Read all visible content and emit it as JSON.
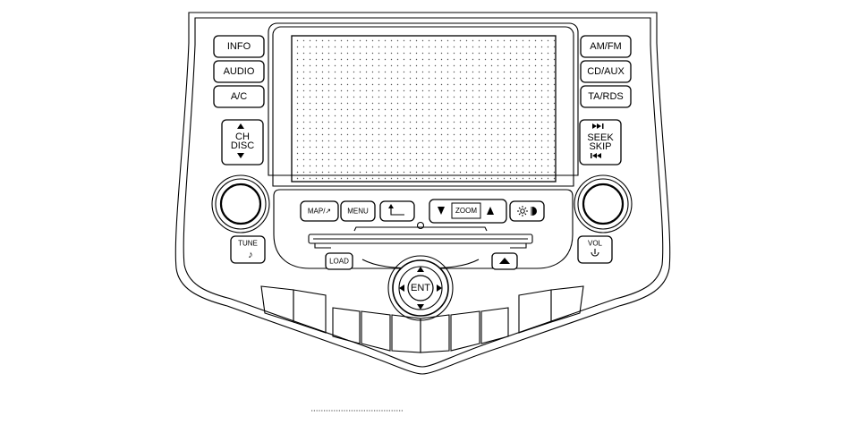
{
  "left_buttons": {
    "info": "INFO",
    "audio": "AUDIO",
    "ac": "A/C"
  },
  "right_buttons": {
    "am_fm": "AM/FM",
    "cd_aux": "CD/AUX",
    "ta_rds": "TA/RDS"
  },
  "ch_disc": {
    "line1": "CH",
    "line2": "DISC"
  },
  "seek_skip": {
    "line1": "SEEK",
    "line2": "SKIP"
  },
  "tune": {
    "label": "TUNE",
    "icon": "music-note-icon"
  },
  "vol": {
    "label": "VOL",
    "icon": "power-icon"
  },
  "screen_row": {
    "map": "MAP/↗",
    "menu": "MENU",
    "zoom": "ZOOM",
    "back_icon": "back-arrow-icon",
    "brightness_icon": "day-night-icon"
  },
  "load": "LOAD",
  "eject_icon": "eject-icon",
  "joystick": {
    "center": "ENT",
    "icons": [
      "arrow-up-icon",
      "arrow-down-icon",
      "arrow-left-icon",
      "arrow-right-icon"
    ]
  }
}
